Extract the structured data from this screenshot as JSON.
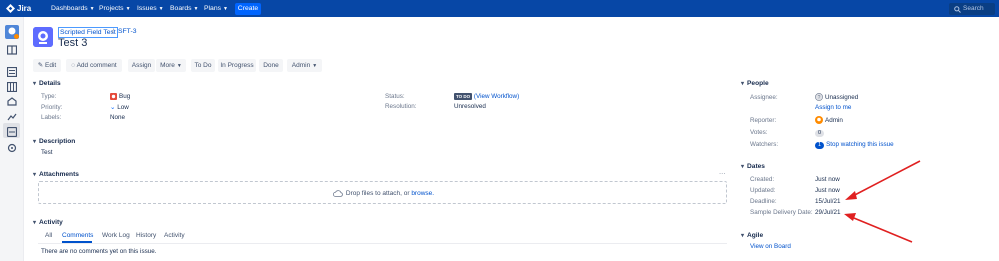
{
  "topnav": {
    "logo": "Jira",
    "items": [
      "Dashboards",
      "Projects",
      "Issues",
      "Boards",
      "Plans"
    ],
    "create_label": "Create",
    "search_placeholder": "Search"
  },
  "breadcrumb": {
    "project": "Scripted Field Test",
    "separator": "/",
    "issue_key": "SFT-3"
  },
  "issue": {
    "title": "Test 3"
  },
  "toolbar": {
    "edit": "Edit",
    "add_comment": "Add comment",
    "assign": "Assign",
    "more": "More",
    "to_do": "To Do",
    "in_progress": "In Progress",
    "done": "Done",
    "admin": "Admin"
  },
  "details": {
    "heading": "Details",
    "type_label": "Type:",
    "type_value": "Bug",
    "priority_label": "Priority:",
    "priority_value": "Low",
    "labels_label": "Labels:",
    "labels_value": "None",
    "status_label": "Status:",
    "status_badge": "TO DO",
    "status_link": "(View Workflow)",
    "resolution_label": "Resolution:",
    "resolution_value": "Unresolved"
  },
  "description": {
    "heading": "Description",
    "text": "Test"
  },
  "attachments": {
    "heading": "Attachments",
    "more": "···",
    "drop_text": "Drop files to attach, or",
    "browse": "browse."
  },
  "activity": {
    "heading": "Activity",
    "tabs": [
      "All",
      "Comments",
      "Work Log",
      "History",
      "Activity"
    ],
    "empty": "There are no comments yet on this issue."
  },
  "people": {
    "heading": "People",
    "assignee_label": "Assignee:",
    "assignee_value": "Unassigned",
    "assign_to_me": "Assign to me",
    "reporter_label": "Reporter:",
    "reporter_value": "Admin",
    "votes_label": "Votes:",
    "votes_value": "0",
    "watchers_label": "Watchers:",
    "watchers_count": "1",
    "watchers_link": "Stop watching this issue"
  },
  "dates": {
    "heading": "Dates",
    "created_label": "Created:",
    "created_value": "Just now",
    "updated_label": "Updated:",
    "updated_value": "Just now",
    "deadline_label": "Deadline:",
    "deadline_value": "15/Jul/21",
    "sample_label": "Sample Delivery Date:",
    "sample_value": "29/Jul/21"
  },
  "agile": {
    "heading": "Agile",
    "view_on_board": "View on Board"
  },
  "colors": {
    "nav": "#0747a6",
    "link": "#0052cc",
    "annotation_arrow": "#e02020"
  }
}
